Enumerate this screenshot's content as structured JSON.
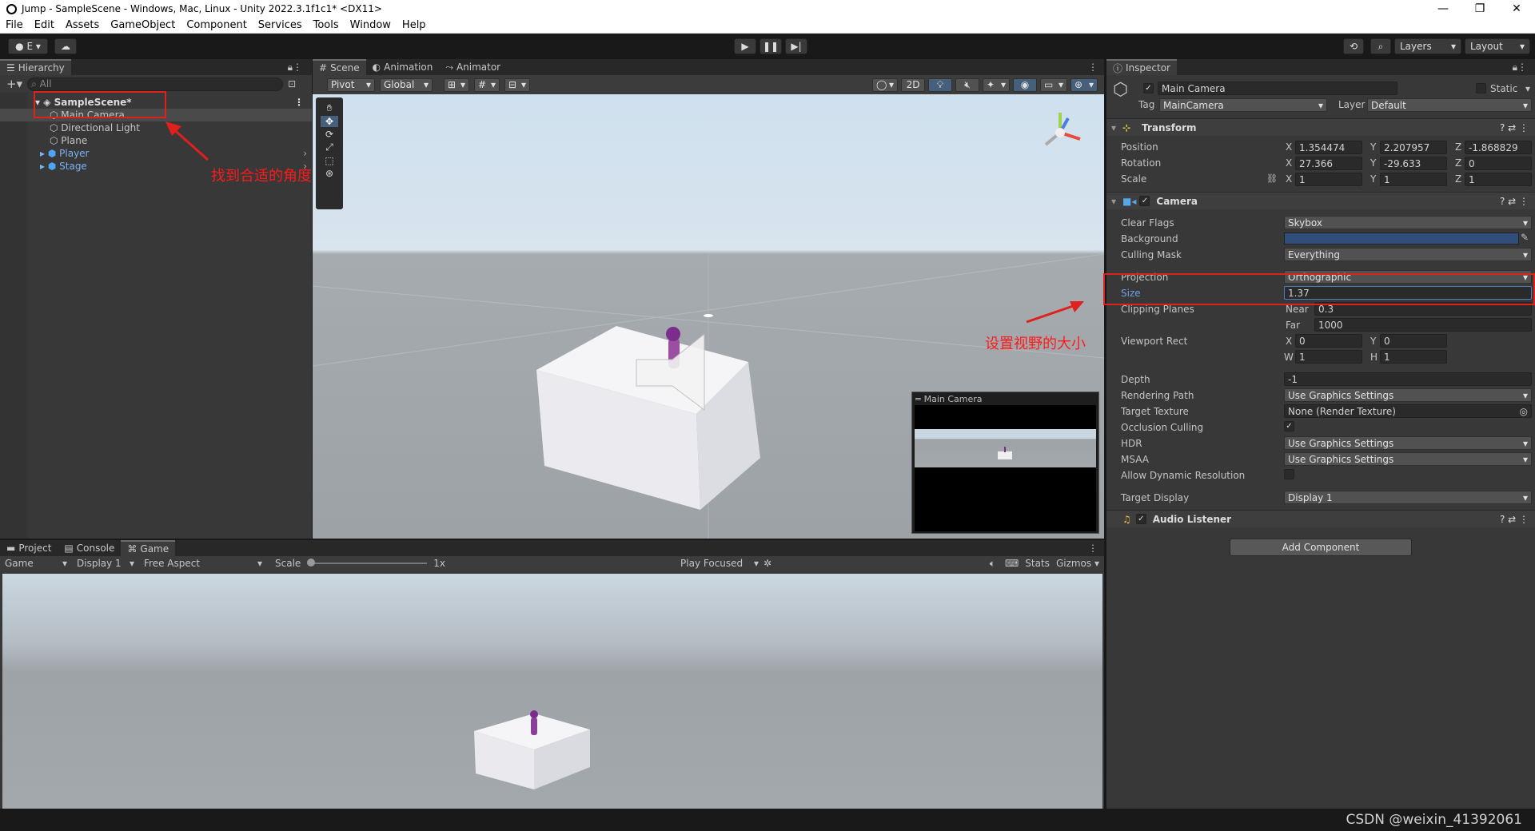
{
  "window": {
    "title": "Jump - SampleScene - Windows, Mac, Linux - Unity 2022.3.1f1c1* <DX11>",
    "minimize": "—",
    "maximize": "❐",
    "close": "✕"
  },
  "menu": [
    "File",
    "Edit",
    "Assets",
    "GameObject",
    "Component",
    "Services",
    "Tools",
    "Window",
    "Help"
  ],
  "toolbar": {
    "account_label": "E",
    "layers_label": "Layers",
    "layout_label": "Layout"
  },
  "hierarchy": {
    "tab": "Hierarchy",
    "search_placeholder": "All",
    "scene": "SampleScene*",
    "items": [
      {
        "label": "Main Camera"
      },
      {
        "label": "Directional Light"
      },
      {
        "label": "Plane"
      },
      {
        "label": "Player"
      },
      {
        "label": "Stage"
      }
    ]
  },
  "scene": {
    "tabs": [
      "Scene",
      "Animation",
      "Animator"
    ],
    "pivot": "Pivot",
    "global": "Global",
    "mode_2d": "2D",
    "camera_preview_title": "Main Camera"
  },
  "game": {
    "tabs": [
      "Project",
      "Console",
      "Game"
    ],
    "view": "Game",
    "display": "Display 1",
    "aspect": "Free Aspect",
    "scale_label": "Scale",
    "scale_value": "1x",
    "play_focused": "Play Focused",
    "stats": "Stats",
    "gizmos": "Gizmos"
  },
  "inspector": {
    "tab": "Inspector",
    "object_name": "Main Camera",
    "static_label": "Static",
    "tag_label": "Tag",
    "tag_value": "MainCamera",
    "layer_label": "Layer",
    "layer_value": "Default",
    "transform": {
      "title": "Transform",
      "position_label": "Position",
      "rotation_label": "Rotation",
      "scale_label": "Scale",
      "position": {
        "x": "1.354474",
        "y": "2.207957",
        "z": "-1.868829"
      },
      "rotation": {
        "x": "27.366",
        "y": "-29.633",
        "z": "0"
      },
      "scale": {
        "x": "1",
        "y": "1",
        "z": "1"
      }
    },
    "camera": {
      "title": "Camera",
      "clear_flags_label": "Clear Flags",
      "clear_flags": "Skybox",
      "background_label": "Background",
      "background_color": "#314d79",
      "culling_mask_label": "Culling Mask",
      "culling_mask": "Everything",
      "projection_label": "Projection",
      "projection": "Orthographic",
      "size_label": "Size",
      "size": "1.37",
      "clipping_label": "Clipping Planes",
      "near_label": "Near",
      "near": "0.3",
      "far_label": "Far",
      "far": "1000",
      "viewport_label": "Viewport Rect",
      "viewport": {
        "x": "0",
        "y": "0",
        "w": "1",
        "h": "1"
      },
      "depth_label": "Depth",
      "depth": "-1",
      "rendering_path_label": "Rendering Path",
      "rendering_path": "Use Graphics Settings",
      "target_texture_label": "Target Texture",
      "target_texture": "None (Render Texture)",
      "occlusion_label": "Occlusion Culling",
      "hdr_label": "HDR",
      "hdr": "Use Graphics Settings",
      "msaa_label": "MSAA",
      "msaa": "Use Graphics Settings",
      "dynres_label": "Allow Dynamic Resolution",
      "target_display_label": "Target Display",
      "target_display": "Display 1"
    },
    "audio_listener": "Audio Listener",
    "add_component": "Add Component"
  },
  "annotations": {
    "camera_hint": "找到合适的角度 对齐摄像机",
    "size_hint": "设置视野的大小"
  },
  "watermark": "CSDN @weixin_41392061"
}
